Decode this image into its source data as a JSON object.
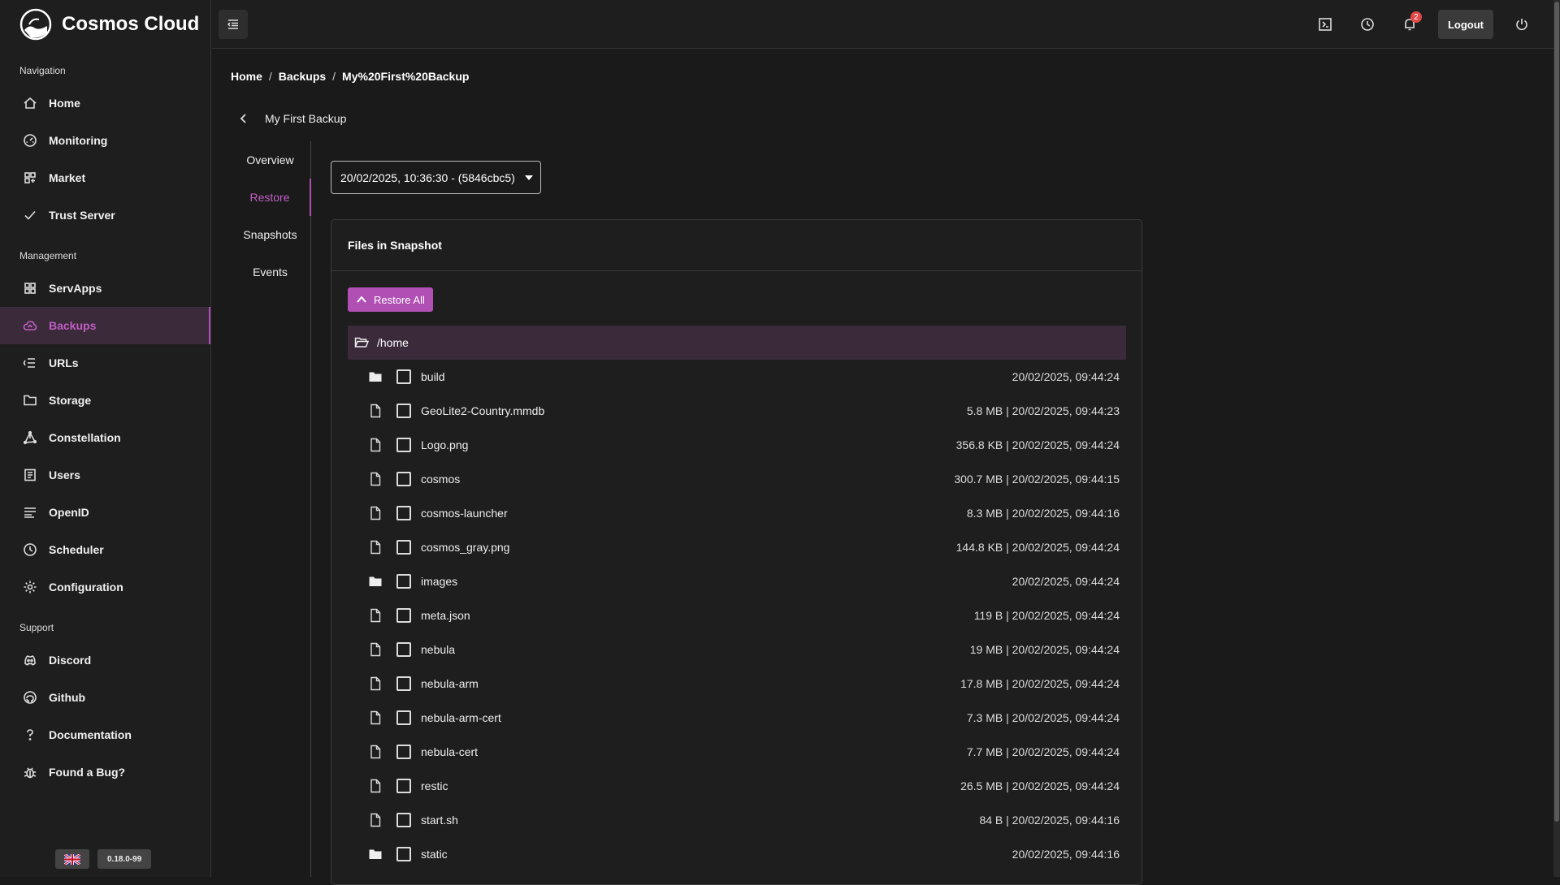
{
  "app": {
    "name": "Cosmos Cloud",
    "version": "0.18.0-99"
  },
  "sidebar": {
    "sections": [
      {
        "title": "Navigation",
        "items": [
          {
            "label": "Home",
            "icon": "home-icon"
          },
          {
            "label": "Monitoring",
            "icon": "dashboard-icon"
          },
          {
            "label": "Market",
            "icon": "market-icon"
          },
          {
            "label": "Trust Server",
            "icon": "check-icon"
          }
        ]
      },
      {
        "title": "Management",
        "items": [
          {
            "label": "ServApps",
            "icon": "apps-icon"
          },
          {
            "label": "Backups",
            "icon": "cloud-icon",
            "active": true
          },
          {
            "label": "URLs",
            "icon": "urls-icon"
          },
          {
            "label": "Storage",
            "icon": "folder-icon"
          },
          {
            "label": "Constellation",
            "icon": "constellation-icon"
          },
          {
            "label": "Users",
            "icon": "users-icon"
          },
          {
            "label": "OpenID",
            "icon": "openid-icon"
          },
          {
            "label": "Scheduler",
            "icon": "clock-icon"
          },
          {
            "label": "Configuration",
            "icon": "gear-icon"
          }
        ]
      },
      {
        "title": "Support",
        "items": [
          {
            "label": "Discord",
            "icon": "discord-icon"
          },
          {
            "label": "Github",
            "icon": "github-icon"
          },
          {
            "label": "Documentation",
            "icon": "question-icon"
          },
          {
            "label": "Found a Bug?",
            "icon": "bug-icon"
          }
        ]
      }
    ]
  },
  "topbar": {
    "logout_label": "Logout",
    "notification_count": "2"
  },
  "breadcrumb": [
    "Home",
    "Backups",
    "My%20First%20Backup"
  ],
  "backup": {
    "title": "My First Backup"
  },
  "subnav": [
    {
      "label": "Overview"
    },
    {
      "label": "Restore",
      "active": true
    },
    {
      "label": "Snapshots"
    },
    {
      "label": "Events"
    }
  ],
  "snapshot_select": {
    "value": "20/02/2025, 10:36:30 - (5846cbc5)"
  },
  "files_card": {
    "title": "Files in Snapshot",
    "restore_all_label": "Restore All",
    "root_path": "/home",
    "files": [
      {
        "type": "folder",
        "name": "build",
        "meta": "20/02/2025, 09:44:24"
      },
      {
        "type": "file",
        "name": "GeoLite2-Country.mmdb",
        "meta": "5.8 MB | 20/02/2025, 09:44:23"
      },
      {
        "type": "file",
        "name": "Logo.png",
        "meta": "356.8 KB | 20/02/2025, 09:44:24"
      },
      {
        "type": "file",
        "name": "cosmos",
        "meta": "300.7 MB | 20/02/2025, 09:44:15"
      },
      {
        "type": "file",
        "name": "cosmos-launcher",
        "meta": "8.3 MB | 20/02/2025, 09:44:16"
      },
      {
        "type": "file",
        "name": "cosmos_gray.png",
        "meta": "144.8 KB | 20/02/2025, 09:44:24"
      },
      {
        "type": "folder",
        "name": "images",
        "meta": "20/02/2025, 09:44:24"
      },
      {
        "type": "file",
        "name": "meta.json",
        "meta": "119 B | 20/02/2025, 09:44:24"
      },
      {
        "type": "file",
        "name": "nebula",
        "meta": "19 MB | 20/02/2025, 09:44:24"
      },
      {
        "type": "file",
        "name": "nebula-arm",
        "meta": "17.8 MB | 20/02/2025, 09:44:24"
      },
      {
        "type": "file",
        "name": "nebula-arm-cert",
        "meta": "7.3 MB | 20/02/2025, 09:44:24"
      },
      {
        "type": "file",
        "name": "nebula-cert",
        "meta": "7.7 MB | 20/02/2025, 09:44:24"
      },
      {
        "type": "file",
        "name": "restic",
        "meta": "26.5 MB | 20/02/2025, 09:44:24"
      },
      {
        "type": "file",
        "name": "start.sh",
        "meta": "84 B | 20/02/2025, 09:44:16"
      },
      {
        "type": "folder",
        "name": "static",
        "meta": "20/02/2025, 09:44:16"
      }
    ]
  },
  "colors": {
    "accent": "#b04fb4",
    "active_bg": "#3a2a3a",
    "background": "#1a1a1a",
    "panel": "#1e1e1e"
  }
}
